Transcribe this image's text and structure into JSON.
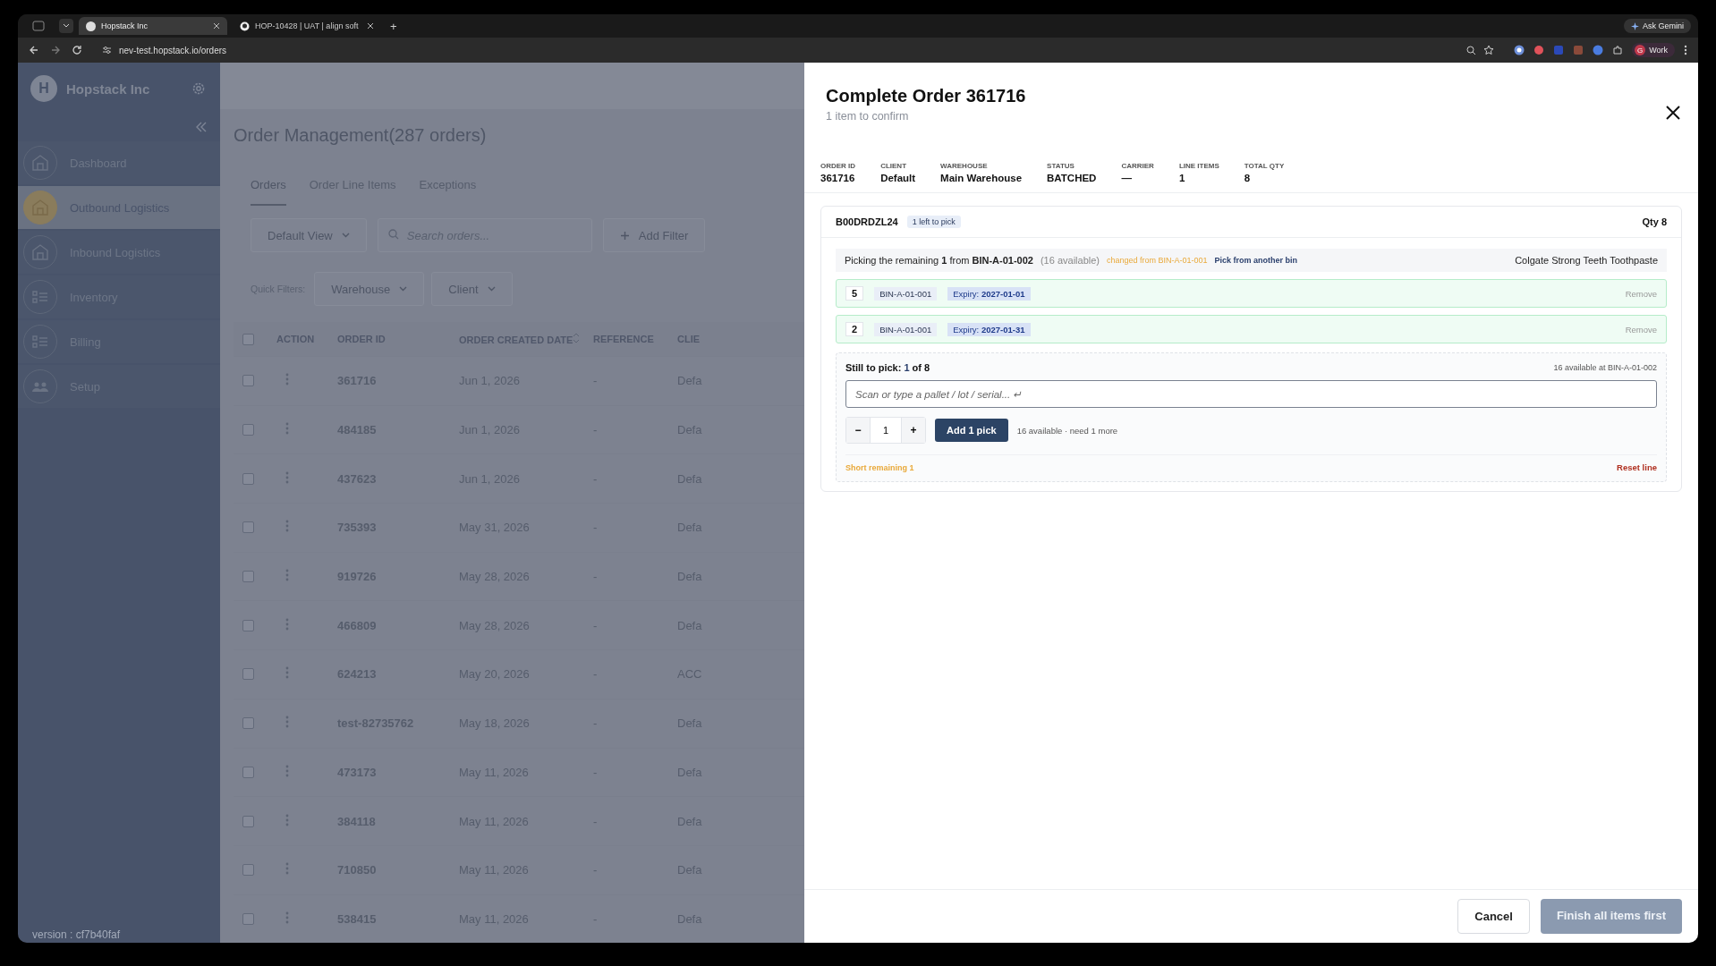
{
  "browser": {
    "tabs": [
      {
        "title": "Hopstack Inc",
        "selected": true,
        "kind": "app"
      },
      {
        "title": "HOP-10428 | UAT | align soft",
        "selected": false,
        "kind": "github"
      }
    ],
    "new_tab": "+",
    "url": "nev-test.hopstack.io/orders",
    "ask": "Ask Gemini",
    "profile": "Work",
    "profile_initial": "G"
  },
  "sidebar": {
    "org": "Hopstack Inc",
    "org_initial": "H",
    "items": [
      {
        "label": "Dashboard",
        "selected": false,
        "kind": "building"
      },
      {
        "label": "Outbound Logistics",
        "selected": true,
        "kind": "building"
      },
      {
        "label": "Inbound Logistics",
        "selected": false,
        "kind": "building"
      },
      {
        "label": "Inventory",
        "selected": false,
        "kind": "list"
      },
      {
        "label": "Billing",
        "selected": false,
        "kind": "list"
      },
      {
        "label": "Setup",
        "selected": false,
        "kind": "group"
      }
    ],
    "version": "version : cf7b40faf"
  },
  "main": {
    "title": "Order Management(287 orders)",
    "tabs": [
      {
        "label": "Orders",
        "selected": true
      },
      {
        "label": "Order Line Items",
        "selected": false
      },
      {
        "label": "Exceptions",
        "selected": false
      }
    ],
    "view": "Default View",
    "search": {
      "placeholder": "Search orders..."
    },
    "add_filter": "Add Filter",
    "quick_filters_label": "Quick Filters:",
    "quick_filters": [
      "Warehouse",
      "Client"
    ],
    "table": {
      "all_checked": false,
      "columns": [
        "ACTION",
        "ORDER ID",
        "ORDER CREATED DATE",
        "REFERENCE",
        "CLIE"
      ],
      "rows": [
        {
          "checked": false,
          "order_id": "361716",
          "date": "Jun 1, 2026",
          "reference": "-",
          "client": "Defa"
        },
        {
          "checked": false,
          "order_id": "484185",
          "date": "Jun 1, 2026",
          "reference": "-",
          "client": "Defa"
        },
        {
          "checked": false,
          "order_id": "437623",
          "date": "Jun 1, 2026",
          "reference": "-",
          "client": "Defa"
        },
        {
          "checked": false,
          "order_id": "735393",
          "date": "May 31, 2026",
          "reference": "-",
          "client": "Defa"
        },
        {
          "checked": false,
          "order_id": "919726",
          "date": "May 28, 2026",
          "reference": "-",
          "client": "Defa"
        },
        {
          "checked": false,
          "order_id": "466809",
          "date": "May 28, 2026",
          "reference": "-",
          "client": "Defa"
        },
        {
          "checked": false,
          "order_id": "624213",
          "date": "May 20, 2026",
          "reference": "-",
          "client": "ACC"
        },
        {
          "checked": false,
          "order_id": "test-82735762",
          "date": "May 18, 2026",
          "reference": "-",
          "client": "Defa"
        },
        {
          "checked": false,
          "order_id": "473173",
          "date": "May 11, 2026",
          "reference": "-",
          "client": "Defa"
        },
        {
          "checked": false,
          "order_id": "384118",
          "date": "May 11, 2026",
          "reference": "-",
          "client": "Defa"
        },
        {
          "checked": false,
          "order_id": "710850",
          "date": "May 11, 2026",
          "reference": "-",
          "client": "Defa"
        },
        {
          "checked": false,
          "order_id": "538415",
          "date": "May 11, 2026",
          "reference": "-",
          "client": "Defa"
        }
      ]
    }
  },
  "panel": {
    "title": "Complete Order 361716",
    "subtitle": "1 item to confirm",
    "meta": [
      {
        "label": "ORDER ID",
        "value": "361716"
      },
      {
        "label": "CLIENT",
        "value": "Default"
      },
      {
        "label": "WAREHOUSE",
        "value": "Main Warehouse"
      },
      {
        "label": "STATUS",
        "value": "BATCHED"
      },
      {
        "label": "CARRIER",
        "value": "—"
      },
      {
        "label": "LINE ITEMS",
        "value": "1"
      },
      {
        "label": "TOTAL QTY",
        "value": "8"
      }
    ],
    "line": {
      "sku": "B00DRDZL24",
      "badge": "1 left to pick",
      "qty": "Qty 8",
      "picking": "Picking the remaining **1** from **BIN-A-01-002**",
      "available": "(16 available)",
      "changed": "changed from BIN-A-01-001",
      "another_bin": "Pick from another bin",
      "product": "Colgate Strong Teeth Toothpaste",
      "picks": [
        {
          "qty": "5",
          "bin": "BIN-A-01-001",
          "expiry": "Expiry: **2027-01-01**",
          "remove": "Remove"
        },
        {
          "qty": "2",
          "bin": "BIN-A-01-001",
          "expiry": "Expiry: **2027-01-31**",
          "remove": "Remove"
        }
      ],
      "still_label": "Still to pick:",
      "still_count": "1",
      "still_total": "of 8",
      "available_at": "16 available at BIN-A-01-002",
      "scan": {
        "placeholder": "Scan or type a pallet / lot / serial... ↵"
      },
      "minus": "−",
      "quantity": "1",
      "plus": "+",
      "add_button": "Add 1 pick",
      "hint": "16 available · need 1 more",
      "short": "Short remaining 1",
      "reset": "Reset line"
    }
  },
  "footer": {
    "cancel": "Cancel",
    "finish": {
      "label": "Finish all items first",
      "disabled": true
    }
  }
}
